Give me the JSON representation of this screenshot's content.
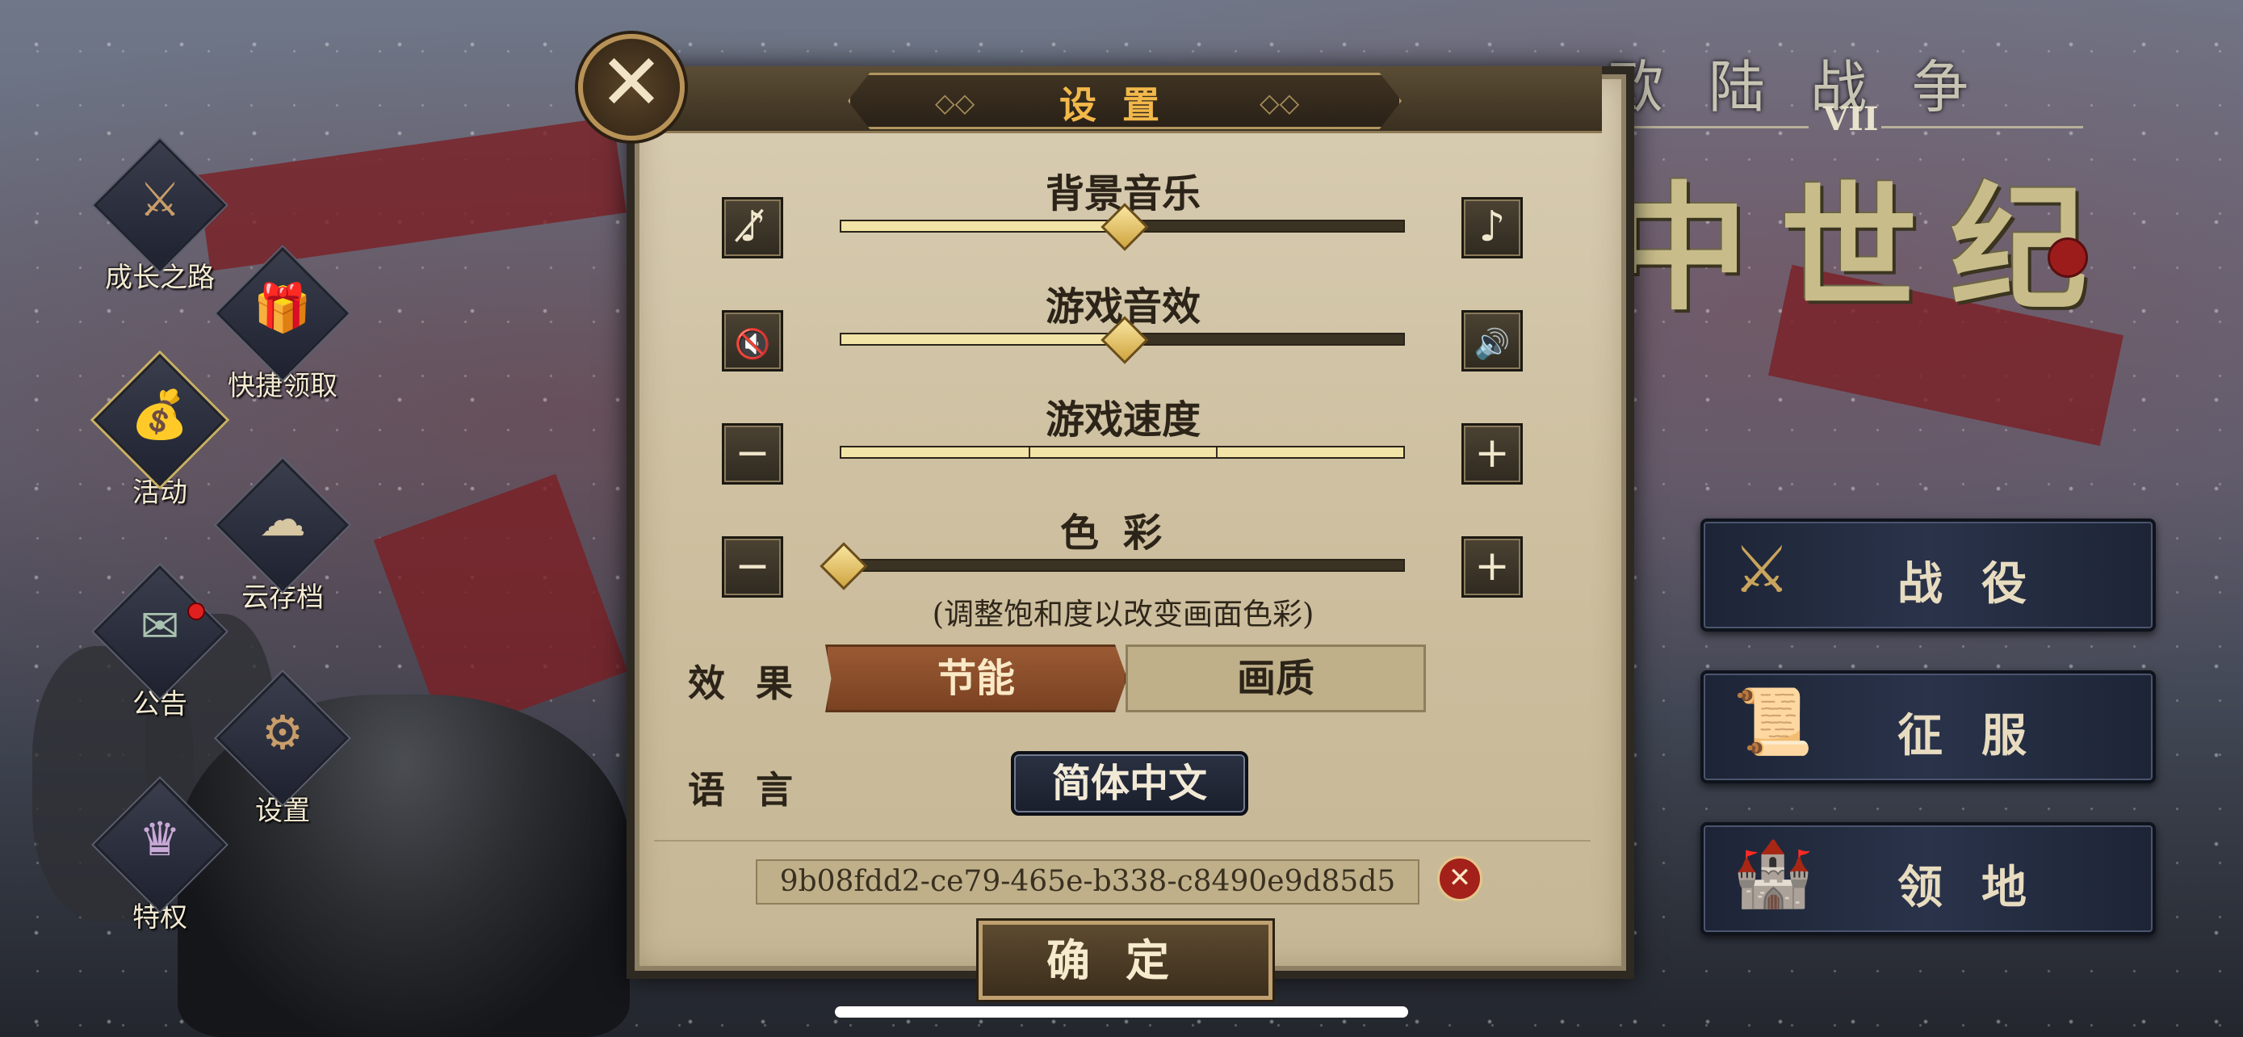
{
  "game": {
    "title_top": "欧陆战争",
    "title_roman": "VII",
    "title_main": "中世纪"
  },
  "left_menu": [
    {
      "label": "成长之路",
      "icon": "growth-path-icon"
    },
    {
      "label": "快捷领取",
      "icon": "quick-claim-icon"
    },
    {
      "label": "活动",
      "icon": "event-icon"
    },
    {
      "label": "云存档",
      "icon": "cloud-save-icon"
    },
    {
      "label": "公告",
      "icon": "announcement-icon"
    },
    {
      "label": "设置",
      "icon": "settings-icon"
    },
    {
      "label": "特权",
      "icon": "privilege-icon"
    }
  ],
  "right_menu": [
    {
      "label": "战役",
      "icon": "crossed-swords-icon"
    },
    {
      "label": "征服",
      "icon": "map-scroll-icon"
    },
    {
      "label": "领地",
      "icon": "castle-icon"
    }
  ],
  "settings": {
    "title": "设置",
    "bg_music": {
      "label": "背景音乐",
      "value": 0.5
    },
    "sfx": {
      "label": "游戏音效",
      "value": 0.5
    },
    "speed": {
      "label": "游戏速度",
      "steps": 3,
      "value": 3
    },
    "color": {
      "label": "色彩",
      "value": 0.0,
      "hint": "(调整饱和度以改变画面色彩)"
    },
    "effect": {
      "label": "效果",
      "options": [
        "节能",
        "画质"
      ],
      "selected": "节能"
    },
    "language": {
      "label": "语言",
      "value": "简体中文"
    },
    "user_id": "9b08fdd2-ce79-465e-b338-c8490e9d85d5",
    "confirm": "确定"
  },
  "colors": {
    "accent_gold": "#f2b84a",
    "selected_effect": "#8a4c2a",
    "notification_dot": "#e02020"
  }
}
